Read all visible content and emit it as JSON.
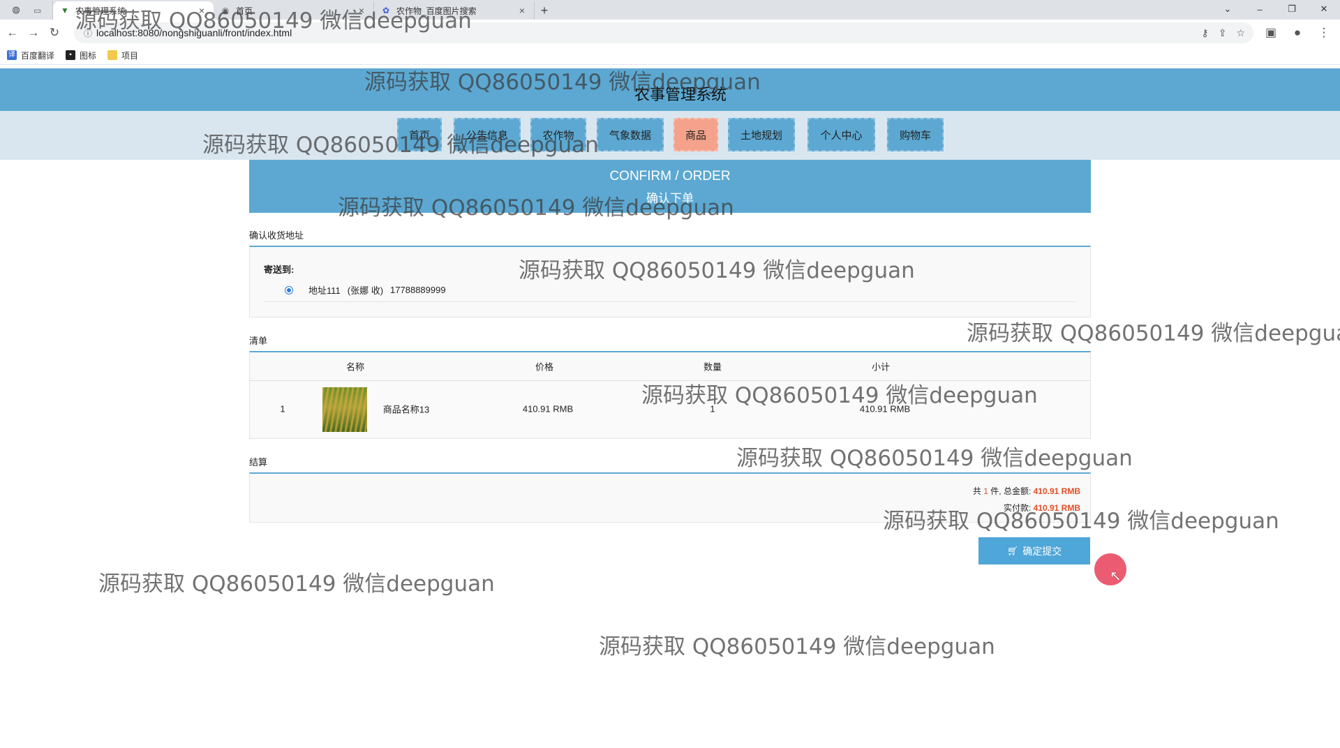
{
  "browser": {
    "tabs": [
      {
        "title": "",
        "favicon": "blank-page-icon"
      },
      {
        "title": "农事管理系统",
        "favicon": "vue-logo-icon"
      },
      {
        "title": "首页",
        "favicon": "globe-icon"
      },
      {
        "title": "农作物_百度图片搜索",
        "favicon": "baidu-paw-icon"
      }
    ],
    "active_tab": 1,
    "address": "localhost:8080/nongshiguanli/front/index.html",
    "bookmarks": [
      "百度翻译",
      "图标",
      "项目"
    ]
  },
  "site": {
    "title": "农事管理系统",
    "nav": [
      "首页",
      "公告信息",
      "农作物",
      "气象数据",
      "商品",
      "土地规划",
      "个人中心",
      "购物车"
    ],
    "active_nav": "商品"
  },
  "banner": {
    "en": "CONFIRM / ORDER",
    "cn": "确认下单"
  },
  "address_section": {
    "label": "确认收货地址",
    "ship_to": "寄送到:",
    "address": "地址111",
    "receiver": "(张娜 收)",
    "phone": "17788889999"
  },
  "list_section": {
    "label": "清单",
    "columns": [
      "名称",
      "价格",
      "数量",
      "小计"
    ],
    "rows": [
      {
        "index": "1",
        "name": "商品名称13",
        "price": "410.91 RMB",
        "qty": "1",
        "subtotal": "410.91 RMB"
      }
    ]
  },
  "settle_section": {
    "label": "结算",
    "count_prefix": "共",
    "count": "1",
    "count_suffix": "件,",
    "total_label": "总金额:",
    "total": "410.91 RMB",
    "paid_label": "实付款:",
    "paid": "410.91 RMB"
  },
  "submit": {
    "label": "确定提交"
  },
  "watermark": "源码获取 QQ86050149 微信deepguan",
  "colors": {
    "primary": "#5ca8d2",
    "active_nav": "#f4a28b",
    "price_red": "#e54d26"
  }
}
